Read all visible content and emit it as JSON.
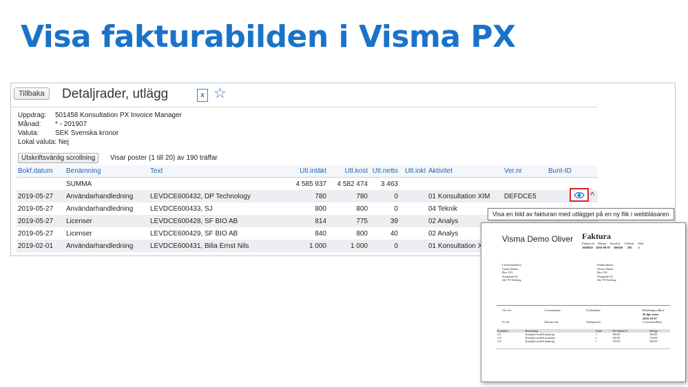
{
  "slide": {
    "title": "Visa fakturabilden i Visma PX"
  },
  "header": {
    "back": "Tillbaka",
    "title": "Detaljrader, utlägg",
    "excel_glyph": "x"
  },
  "info": [
    {
      "label": "Uppdrag:",
      "value": "501458 Konsultation PX Invoice Manager"
    },
    {
      "label": "Månad:",
      "value": "* - 201907"
    },
    {
      "label": "Valuta:",
      "value": "SEK Svenska kronor"
    },
    {
      "label": "Lokal valuta:",
      "value": "Nej"
    }
  ],
  "toolbar": {
    "scroll_btn": "Utskriftsvänlig scrollning",
    "hits": "Visar poster (1 till 20) av  190 träffar"
  },
  "table": {
    "headers": [
      "Bokf.datum",
      "Benämning",
      "Text",
      "Utl.intäkt",
      "Utl.kost",
      "Utl.netto",
      "Utl.inkl",
      "Aktivitet",
      "Ver.nr",
      "Bunt-ID"
    ],
    "summa": {
      "label": "SUMMA",
      "intakt": "4 585 937",
      "kost": "4 582 474",
      "netto": "3 463"
    },
    "rows": [
      {
        "date": "2019-05-27",
        "ben": "Användarhandledning",
        "text": "LEVDCE600432, DP Technology",
        "intakt": "780",
        "kost": "780",
        "netto": "0",
        "akt": "01 Konsultation XIM",
        "ver": "DEFDCE5"
      },
      {
        "date": "2019-05-27",
        "ben": "Användarhandledning",
        "text": "LEVDCE600433, SJ",
        "intakt": "800",
        "kost": "800",
        "netto": "0",
        "akt": "04 Teknik",
        "ver": ""
      },
      {
        "date": "2019-05-27",
        "ben": "Licenser",
        "text": "LEVDCE600428, SF BIO AB",
        "intakt": "814",
        "kost": "775",
        "netto": "39",
        "akt": "02 Analys",
        "ver": ""
      },
      {
        "date": "2019-05-27",
        "ben": "Licenser",
        "text": "LEVDCE600429, SF BIO AB",
        "intakt": "840",
        "kost": "800",
        "netto": "40",
        "akt": "02 Analys",
        "ver": ""
      },
      {
        "date": "2019-02-01",
        "ben": "Användarhandledning",
        "text": "LEVDCE600431, Bilia Ernst Nils",
        "intakt": "1 000",
        "kost": "1 000",
        "netto": "0",
        "akt": "01 Konsultation XIM",
        "ver": ""
      }
    ]
  },
  "tooltip": "Visa en bild av fakturan med utlägget på en ny flik i webbläsaren",
  "invoice": {
    "company": "Visma Demo Oliver",
    "title": "Faktura",
    "meta_headers": [
      "Faktura nr",
      "Datum",
      "Kund nr",
      "Ordernr",
      "Sida"
    ],
    "meta_values": [
      "1000020",
      "2016-09-07",
      "100020",
      "285",
      "1"
    ],
    "lev_label": "Leveransadress:",
    "fak_label": "Fakturadress:",
    "lev_addr": [
      "Visma Demo",
      "Box 101",
      "Storgatan 32",
      "442 70 Varberg"
    ],
    "fak_addr": [
      "Visma Demo",
      "Box 101",
      "Storgatan 32",
      "442 70 Varberg"
    ],
    "row1": [
      "Vår ref.",
      "Leveranssätt",
      "Godsmärke",
      "Betalningsvillkor"
    ],
    "terms": [
      "30 dgr netto",
      "2016-10-07"
    ],
    "row2": [
      "Er ref.",
      "Datum ord",
      "Transportör",
      "Leveransvillkor"
    ],
    "items_head": [
      "Produktnr",
      "Benämning",
      "Antal",
      "Pris  Rabatt %",
      "Belopp"
    ],
    "items": [
      [
        "111",
        "Komplett modell landsväg",
        "1",
        "290,00",
        "290,00"
      ],
      [
        "112",
        "Komplett modell mountain",
        "1",
        "320,00",
        "310,00"
      ],
      [
        "113",
        "Komplett modell landsväg",
        "1",
        "310,00",
        "940,00"
      ]
    ]
  }
}
